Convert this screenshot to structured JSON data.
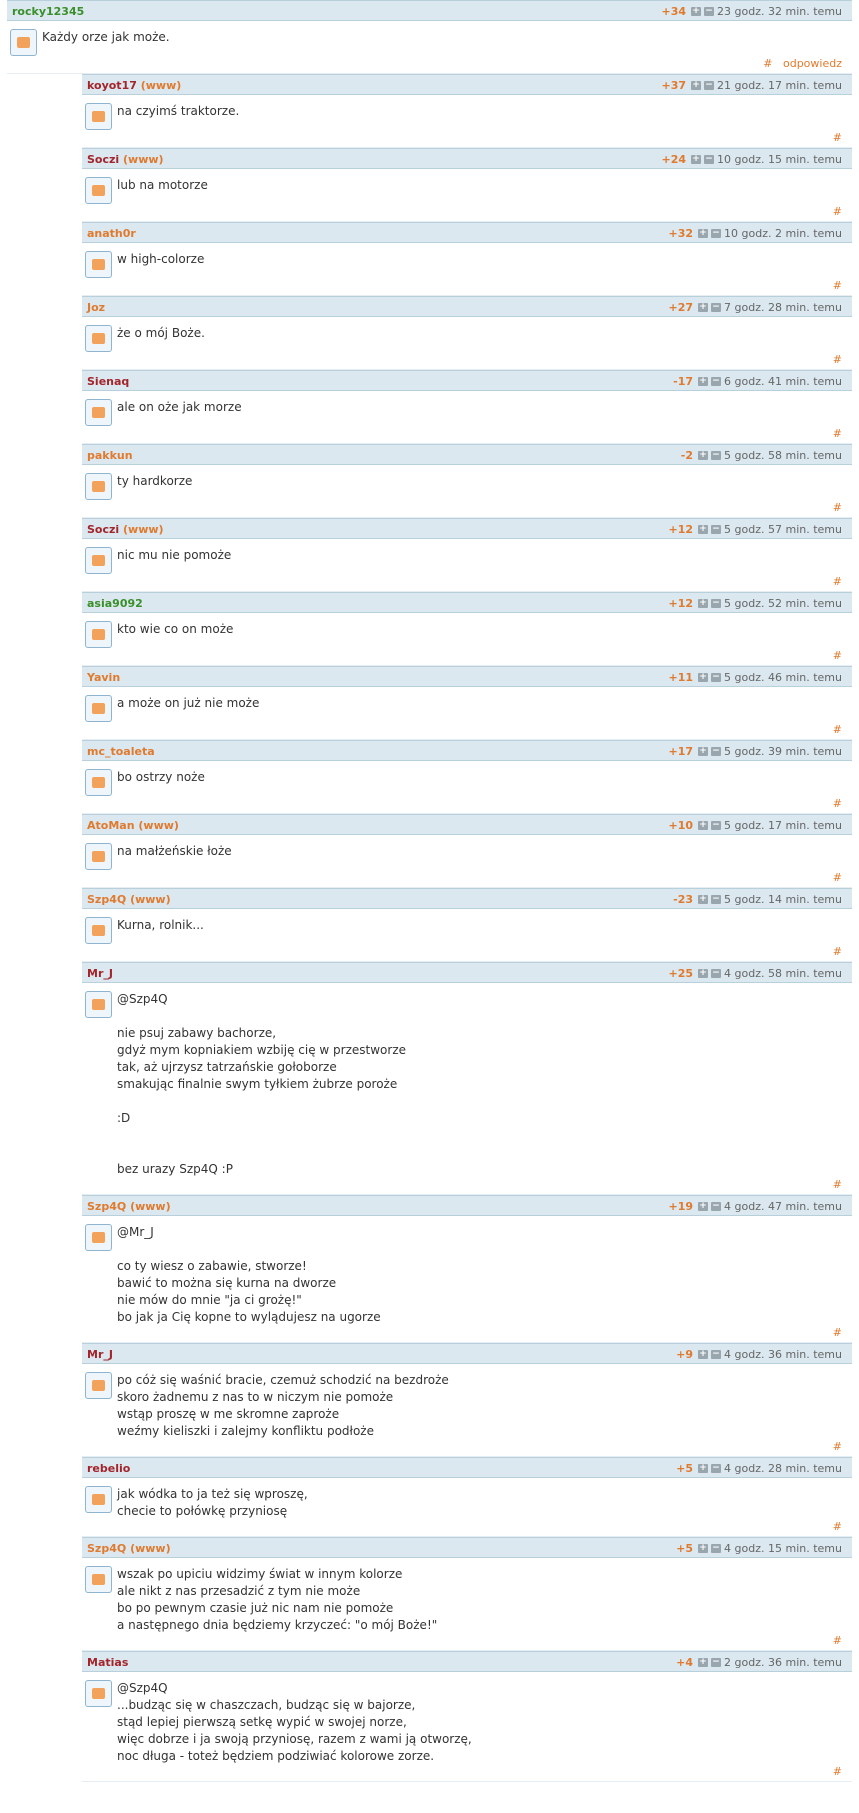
{
  "top": {
    "user": "rocky12345",
    "score": "+34",
    "time": "23 godz. 32 min. temu",
    "text": "Każdy orze jak może.",
    "reply_label": "odpowiedz",
    "hash": "#"
  },
  "replies": [
    {
      "user": "koyot17",
      "www": "(www)",
      "score": "+37",
      "time": "21 godz. 17 min. temu",
      "text": "na czyimś traktorze.",
      "hash": "#"
    },
    {
      "user": "Soczi",
      "www": "(www)",
      "score": "+24",
      "time": "10 godz. 15 min. temu",
      "text": "lub na motorze",
      "hash": "#"
    },
    {
      "user": "anath0r",
      "www": "",
      "score": "+32",
      "time": "10 godz. 2 min. temu",
      "text": "w high-colorze",
      "hash": "#"
    },
    {
      "user": "Joz",
      "www": "",
      "score": "+27",
      "time": "7 godz. 28 min. temu",
      "text": "że o mój Boże.",
      "hash": "#"
    },
    {
      "user": "Sienaq",
      "www": "",
      "score": "-17",
      "time": "6 godz. 41 min. temu",
      "text": "ale on oże jak morze",
      "hash": "#"
    },
    {
      "user": "pakkun",
      "www": "",
      "score": "-2",
      "time": "5 godz. 58 min. temu",
      "text": "ty hardkorze",
      "hash": "#"
    },
    {
      "user": "Soczi",
      "www": "(www)",
      "score": "+12",
      "time": "5 godz. 57 min. temu",
      "text": "nic mu nie pomoże",
      "hash": "#"
    },
    {
      "user": "asia9092",
      "www": "",
      "score": "+12",
      "time": "5 godz. 52 min. temu",
      "text": "kto wie co on może",
      "hash": "#"
    },
    {
      "user": "Yavin",
      "www": "",
      "score": "+11",
      "time": "5 godz. 46 min. temu",
      "text": "a może on już nie może",
      "hash": "#"
    },
    {
      "user": "mc_toaleta",
      "www": "",
      "score": "+17",
      "time": "5 godz. 39 min. temu",
      "text": "bo ostrzy noże",
      "hash": "#"
    },
    {
      "user": "AtoMan",
      "www": "(www)",
      "score": "+10",
      "time": "5 godz. 17 min. temu",
      "text": "na małżeńskie łoże",
      "hash": "#"
    },
    {
      "user": "Szp4Q",
      "www": "(www)",
      "score": "-23",
      "time": "5 godz. 14 min. temu",
      "text": "Kurna, rolnik...",
      "hash": "#"
    },
    {
      "user": "Mr_J",
      "www": "",
      "score": "+25",
      "time": "4 godz. 58 min. temu",
      "text": "@Szp4Q\n\nnie psuj zabawy bachorze,\ngdyż mym kopniakiem wzbiję cię w przestworze\ntak, aż ujrzysz tatrzańskie gołoborze\nsmakując finalnie swym tyłkiem żubrze poroże\n\n:D\n\n\nbez urazy Szp4Q :P",
      "hash": "#"
    },
    {
      "user": "Szp4Q",
      "www": "(www)",
      "score": "+19",
      "time": "4 godz. 47 min. temu",
      "text": "@Mr_J\n\nco ty wiesz o zabawie, stworze!\nbawić to można się kurna na dworze\nnie mów do mnie \"ja ci grożę!\"\nbo jak ja Cię kopne to wylądujesz na ugorze",
      "hash": "#"
    },
    {
      "user": "Mr_J",
      "www": "",
      "score": "+9",
      "time": "4 godz. 36 min. temu",
      "text": "po cóż się waśnić bracie, czemuż schodzić na bezdroże\nskoro żadnemu z nas to w niczym nie pomoże\nwstąp proszę w me skromne zaproże\nweźmy kieliszki i zalejmy konfliktu podłoże",
      "hash": "#"
    },
    {
      "user": "rebelio",
      "www": "",
      "score": "+5",
      "time": "4 godz. 28 min. temu",
      "text": "jak wódka to ja też się wproszę,\nchecie to połówkę przyniosę",
      "hash": "#"
    },
    {
      "user": "Szp4Q",
      "www": "(www)",
      "score": "+5",
      "time": "4 godz. 15 min. temu",
      "text": "wszak po upiciu widzimy świat w innym kolorze\nale nikt z nas przesadzić z tym nie może\nbo po pewnym czasie już nic nam nie pomoże\na następnego dnia będziemy krzyczeć: \"o mój Boże!\"",
      "hash": "#"
    },
    {
      "user": "Matias",
      "www": "",
      "score": "+4",
      "time": "2 godz. 36 min. temu",
      "text": "@Szp4Q\n...budząc się w chaszczach, budząc się w bajorze,\nstąd lepiej pierwszą setkę wypić w swojej norze,\nwięc dobrze i ja swoją przyniosę, razem z wami ją otworzę,\nnoc długa - toteż będziem podziwiać kolorowe zorze.",
      "hash": "#"
    }
  ],
  "user_colors": {
    "rocky12345": "#3a8f2a",
    "koyot17": "#a3242a",
    "Soczi": "#a3242a",
    "anath0r": "#e07a2e",
    "Joz": "#e07a2e",
    "Sienaq": "#a3242a",
    "pakkun": "#e07a2e",
    "asia9092": "#3a8f2a",
    "Yavin": "#e07a2e",
    "mc_toaleta": "#e07a2e",
    "AtoMan": "#e07a2e",
    "Szp4Q": "#e07a2e",
    "Mr_J": "#a3242a",
    "rebelio": "#a3242a",
    "Matias": "#a3242a"
  },
  "icons": {
    "plus": "plus-icon",
    "minus": "minus-icon",
    "avatar": "avatar-icon"
  }
}
